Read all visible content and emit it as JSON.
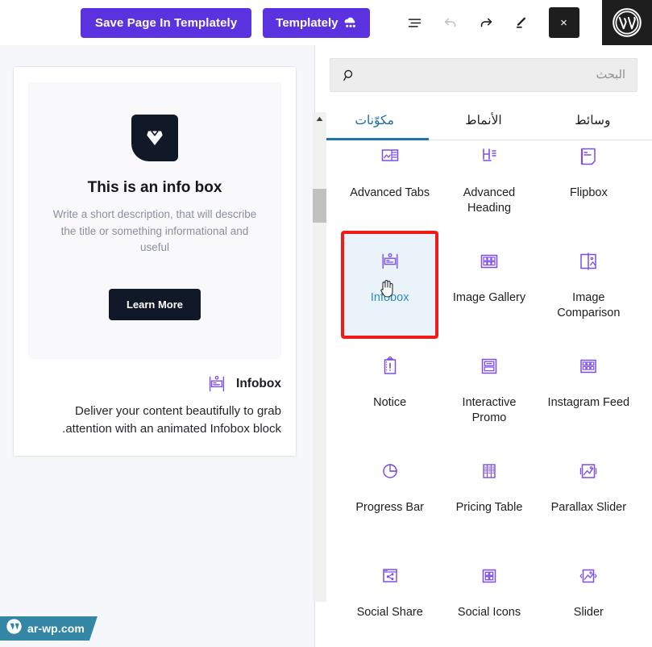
{
  "topbar": {
    "save_label": "Save Page In Templately",
    "templately_label": "Templately",
    "icons": [
      {
        "name": "list-view-icon",
        "title": "List View"
      },
      {
        "name": "undo-icon",
        "title": "Undo"
      },
      {
        "name": "redo-icon",
        "title": "Redo"
      },
      {
        "name": "edit-pencil-icon",
        "title": "Edit"
      }
    ],
    "close_label": "×",
    "wordpress_icon": "wordpress-icon",
    "accent_purple": "#5B32E0",
    "dark": "#1E1E1E"
  },
  "preview": {
    "demo": {
      "icon_name": "diamond-icon",
      "title": "This is an info box",
      "description": "Write a short description, that will describe the title or something informational and useful",
      "button_label": "Learn More"
    },
    "meta": {
      "title": "Infobox",
      "icon_name": "infobox-icon",
      "description": "Deliver your content beautifully to grab attention with an animated Infobox block."
    }
  },
  "watermark": {
    "label": "ar-wp.com",
    "color": "#3487A4",
    "icon_name": "ar-wp-logo-icon"
  },
  "inserter": {
    "search": {
      "placeholder": "البحث",
      "value": "",
      "icon_name": "search-icon"
    },
    "tabs": [
      {
        "label": "مكوّنات",
        "active": true
      },
      {
        "label": "الأنماط",
        "active": false
      },
      {
        "label": "وسائط",
        "active": false
      }
    ],
    "active_tab_color": "#1C76A8",
    "selection_highlight_color": "#EE1B16",
    "blocks": [
      {
        "label": "Flipbox",
        "icon": "flipbox-icon",
        "selected": false
      },
      {
        "label": "Advanced Heading",
        "icon": "advanced-heading-icon",
        "selected": false
      },
      {
        "label": "Advanced Tabs",
        "icon": "advanced-tabs-icon",
        "selected": false
      },
      {
        "label": "Image Comparison",
        "icon": "image-comparison-icon",
        "selected": false
      },
      {
        "label": "Image Gallery",
        "icon": "image-gallery-icon",
        "selected": false
      },
      {
        "label": "Infobox",
        "icon": "infobox-icon",
        "selected": true
      },
      {
        "label": "Instagram Feed",
        "icon": "instagram-feed-icon",
        "selected": false
      },
      {
        "label": "Interactive Promo",
        "icon": "interactive-promo-icon",
        "selected": false
      },
      {
        "label": "Notice",
        "icon": "notice-icon",
        "selected": false
      },
      {
        "label": "Parallax Slider",
        "icon": "parallax-slider-icon",
        "selected": false
      },
      {
        "label": "Pricing Table",
        "icon": "pricing-table-icon",
        "selected": false
      },
      {
        "label": "Progress Bar",
        "icon": "progress-bar-icon",
        "selected": false
      },
      {
        "label": "Slider",
        "icon": "slider-icon",
        "selected": false
      },
      {
        "label": "Social Icons",
        "icon": "social-icons-icon",
        "selected": false
      },
      {
        "label": "Social Share",
        "icon": "social-share-icon",
        "selected": false
      }
    ],
    "scrollbar": {
      "up_arrow_icon": "scroll-up-arrow-icon"
    }
  }
}
